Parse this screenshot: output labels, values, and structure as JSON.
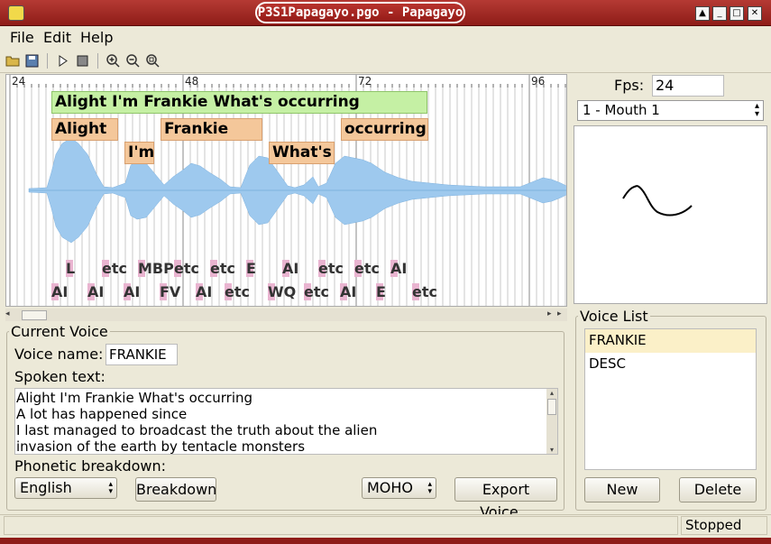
{
  "window": {
    "title": "P3S1Papagayo.pgo - Papagayo"
  },
  "menubar": {
    "items": [
      "File",
      "Edit",
      "Help"
    ]
  },
  "timeline": {
    "ruler_ticks": [
      "24",
      "48",
      "72",
      "96"
    ],
    "phrase": "Alight I'm Frankie What's occurring",
    "words": [
      "Alight",
      "I'm",
      "Frankie",
      "What's",
      "occurring"
    ],
    "phonemes_top": [
      "L",
      "etc",
      "MBP",
      "etc",
      "etc",
      "E",
      "AI",
      "etc",
      "etc",
      "AI"
    ],
    "phonemes_bottom": [
      "AI",
      "AI",
      "AI",
      "FV",
      "AI",
      "etc",
      "WQ",
      "etc",
      "AI",
      "E",
      "etc"
    ],
    "waveform_color": "#9ec9ee"
  },
  "fps": {
    "label": "Fps:",
    "value": "24"
  },
  "mouth": {
    "selected": "1 - Mouth 1"
  },
  "current_voice": {
    "legend": "Current Voice",
    "name_label": "Voice name:",
    "name_value": "FRANKIE",
    "spoken_label": "Spoken text:",
    "spoken_lines": [
      "Alight I'm Frankie What's occurring",
      "A lot has happened since",
      "I last managed to broadcast the truth about the alien",
      "invasion of the earth by tentacle monsters"
    ],
    "phonetic_label": "Phonetic breakdown:",
    "language": "English",
    "breakdown_button": "Breakdown",
    "format": "MOHO",
    "export_button": "Export Voice..."
  },
  "voice_list": {
    "legend": "Voice List",
    "items": [
      "FRANKIE",
      "DESC"
    ],
    "new_button": "New",
    "delete_button": "Delete"
  },
  "status": {
    "text": "Stopped"
  }
}
